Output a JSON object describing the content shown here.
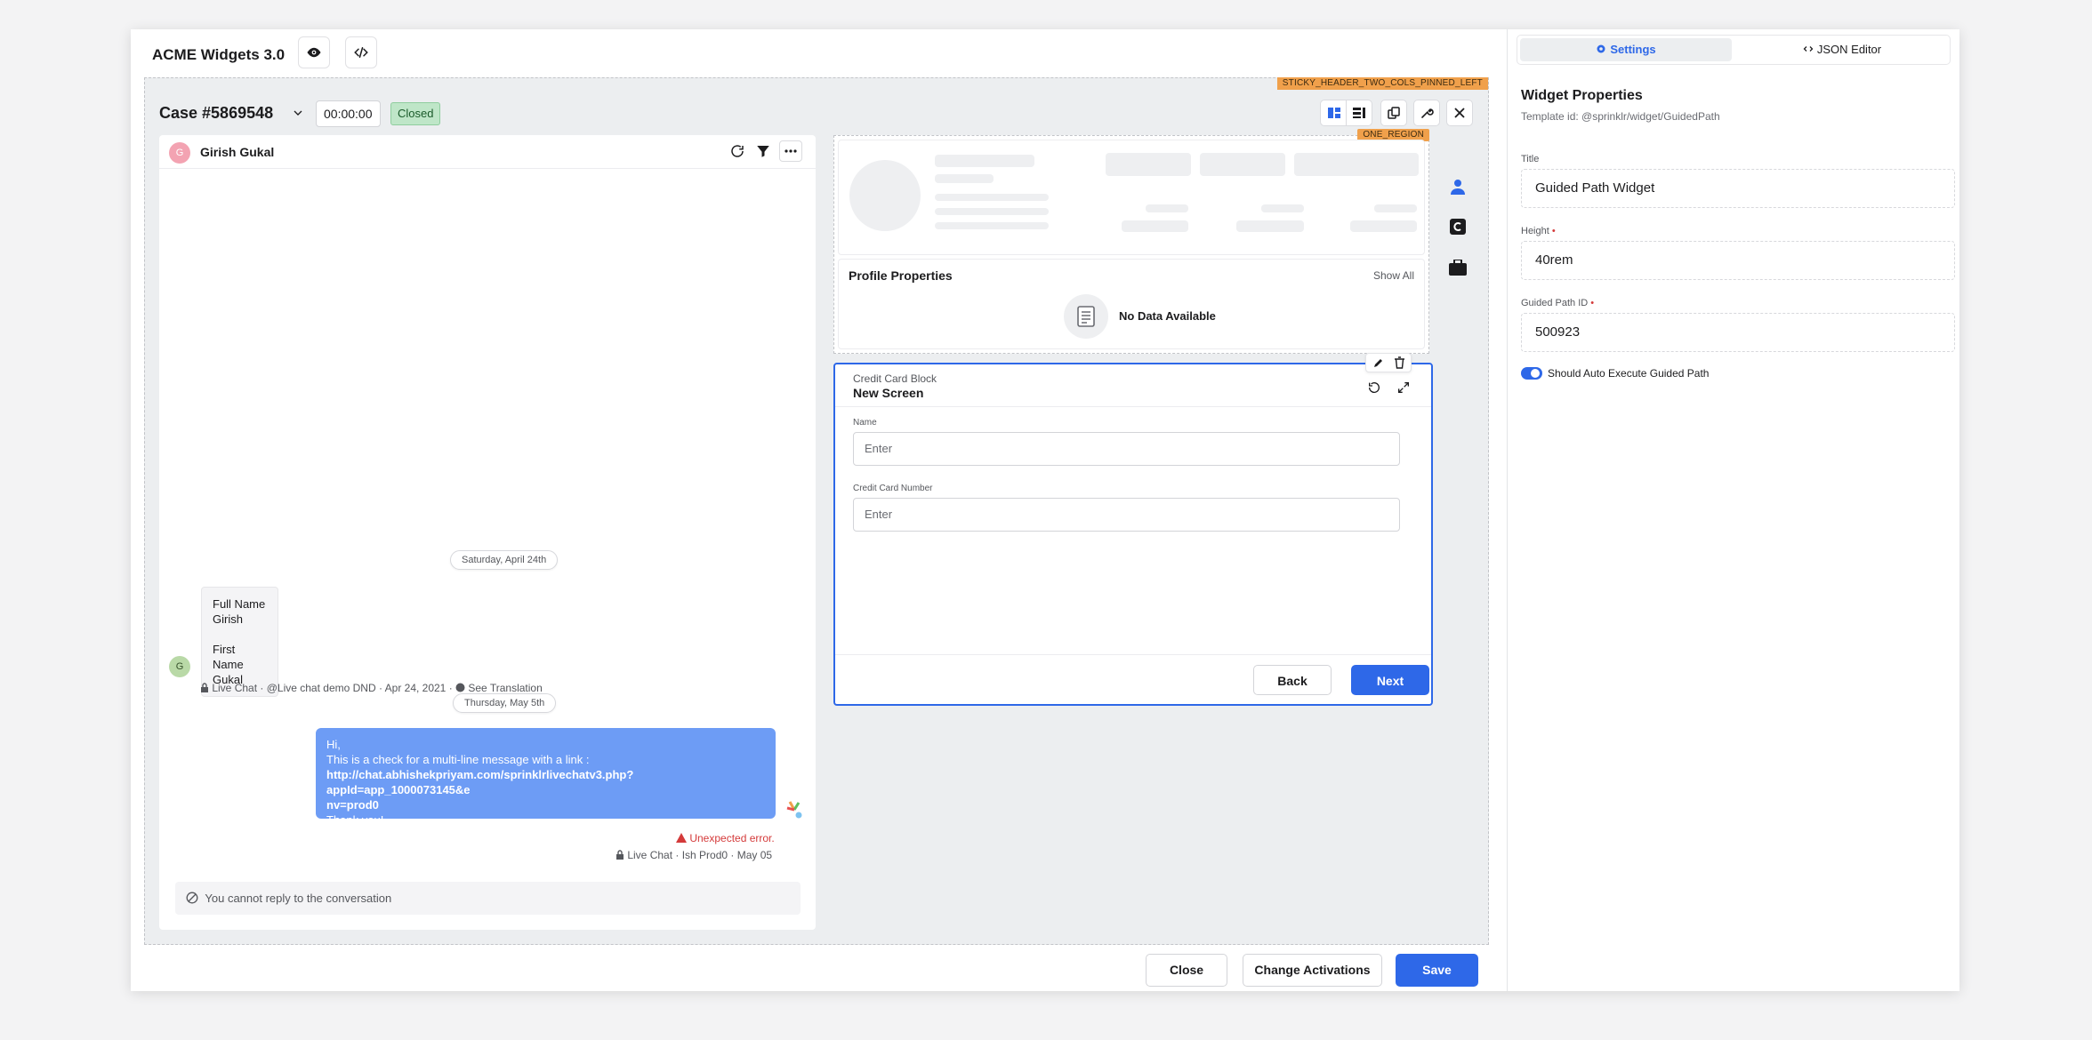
{
  "app": {
    "title": "ACME Widgets 3.0"
  },
  "toolbar": {
    "preview_icon": "eye-icon",
    "code_icon": "code-icon"
  },
  "canvas": {
    "sticky_tag": "STICKY_HEADER_TWO_COLS_PINNED_LEFT",
    "region_tag": "ONE_REGION"
  },
  "case": {
    "title": "Case #5869548",
    "timer": "00:00:00",
    "status": "Closed"
  },
  "conversation": {
    "contact_name": "Girish Gukal",
    "avatar_initial": "G",
    "date1": "Saturday, April 24th",
    "card": {
      "line1": "Full Name",
      "line2": "Girish",
      "line3": "First Name",
      "line4": "Gukal"
    },
    "meta1": {
      "channel": "Live Chat",
      "account": "@Live chat demo DND",
      "date": "Apr 24, 2021",
      "translate": "See Translation"
    },
    "date2": "Thursday, May 5th",
    "message": {
      "line1": "Hi,",
      "line2": "This is a check for a multi-line message with a link :",
      "link1": "http://chat.abhishekpriyam.com/sprinklrlivechatv3.php?appId=app_1000073145&e",
      "link2": "nv=prod0",
      "line3": "Thank you!"
    },
    "error": "Unexpected error.",
    "meta2": "Live Chat · Ish Prod0 · May 05",
    "reply_notice": "You cannot reply to the conversation"
  },
  "profile": {
    "heading": "Profile Properties",
    "show_all": "Show All",
    "empty": "No Data Available"
  },
  "guided": {
    "block_label": "Credit Card Block",
    "screen_title": "New Screen",
    "name_label": "Name",
    "name_placeholder": "Enter",
    "cc_label": "Credit Card Number",
    "cc_placeholder": "Enter",
    "back": "Back",
    "next": "Next"
  },
  "footer": {
    "close": "Close",
    "change": "Change Activations",
    "save": "Save"
  },
  "panel": {
    "tab_settings": "Settings",
    "tab_json": "JSON Editor",
    "heading": "Widget Properties",
    "template": "Template id: @sprinklr/widget/GuidedPath",
    "title_label": "Title",
    "title_value": "Guided Path Widget",
    "height_label": "Height",
    "height_value": "40rem",
    "gp_label": "Guided Path ID",
    "gp_value": "500923",
    "toggle_label": "Should Auto Execute Guided Path",
    "toggle_on": true
  },
  "colors": {
    "accent": "#2e68e8",
    "bubble": "#6d9cf5",
    "closed": "#bfe6c8",
    "tag": "#f0a04b",
    "error": "#d43a3a"
  }
}
